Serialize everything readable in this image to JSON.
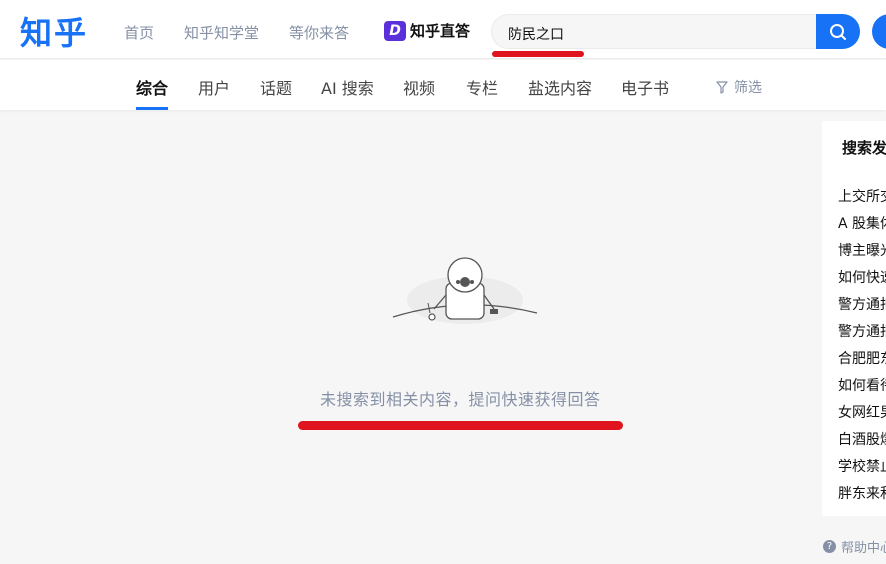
{
  "header": {
    "logo": "知乎",
    "nav": [
      "首页",
      "知乎知学堂",
      "等你来答"
    ],
    "zhida_badge": "D",
    "zhida_label": "知乎直答",
    "search_value": "防民之口",
    "search_icon": "search-icon"
  },
  "tabs": [
    "综合",
    "用户",
    "话题",
    "AI 搜索",
    "视频",
    "专栏",
    "盐选内容",
    "电子书"
  ],
  "filter_label": "筛选",
  "empty_state": {
    "message": "未搜索到相关内容，提问快速获得回答"
  },
  "sidebar": {
    "title": "搜索发",
    "items": [
      "上交所交",
      "A 股集体",
      "博主曝光",
      "如何快速",
      "警方通报",
      "警方通报",
      "合肥肥东",
      "如何看待",
      "女网红男",
      "白酒股爆",
      "学校禁止",
      "胖东来和"
    ]
  },
  "footer": {
    "help_label": "帮助中心"
  },
  "colors": {
    "brand": "#1772f6",
    "annotation_red": "#e0141e",
    "muted": "#8590a6"
  }
}
